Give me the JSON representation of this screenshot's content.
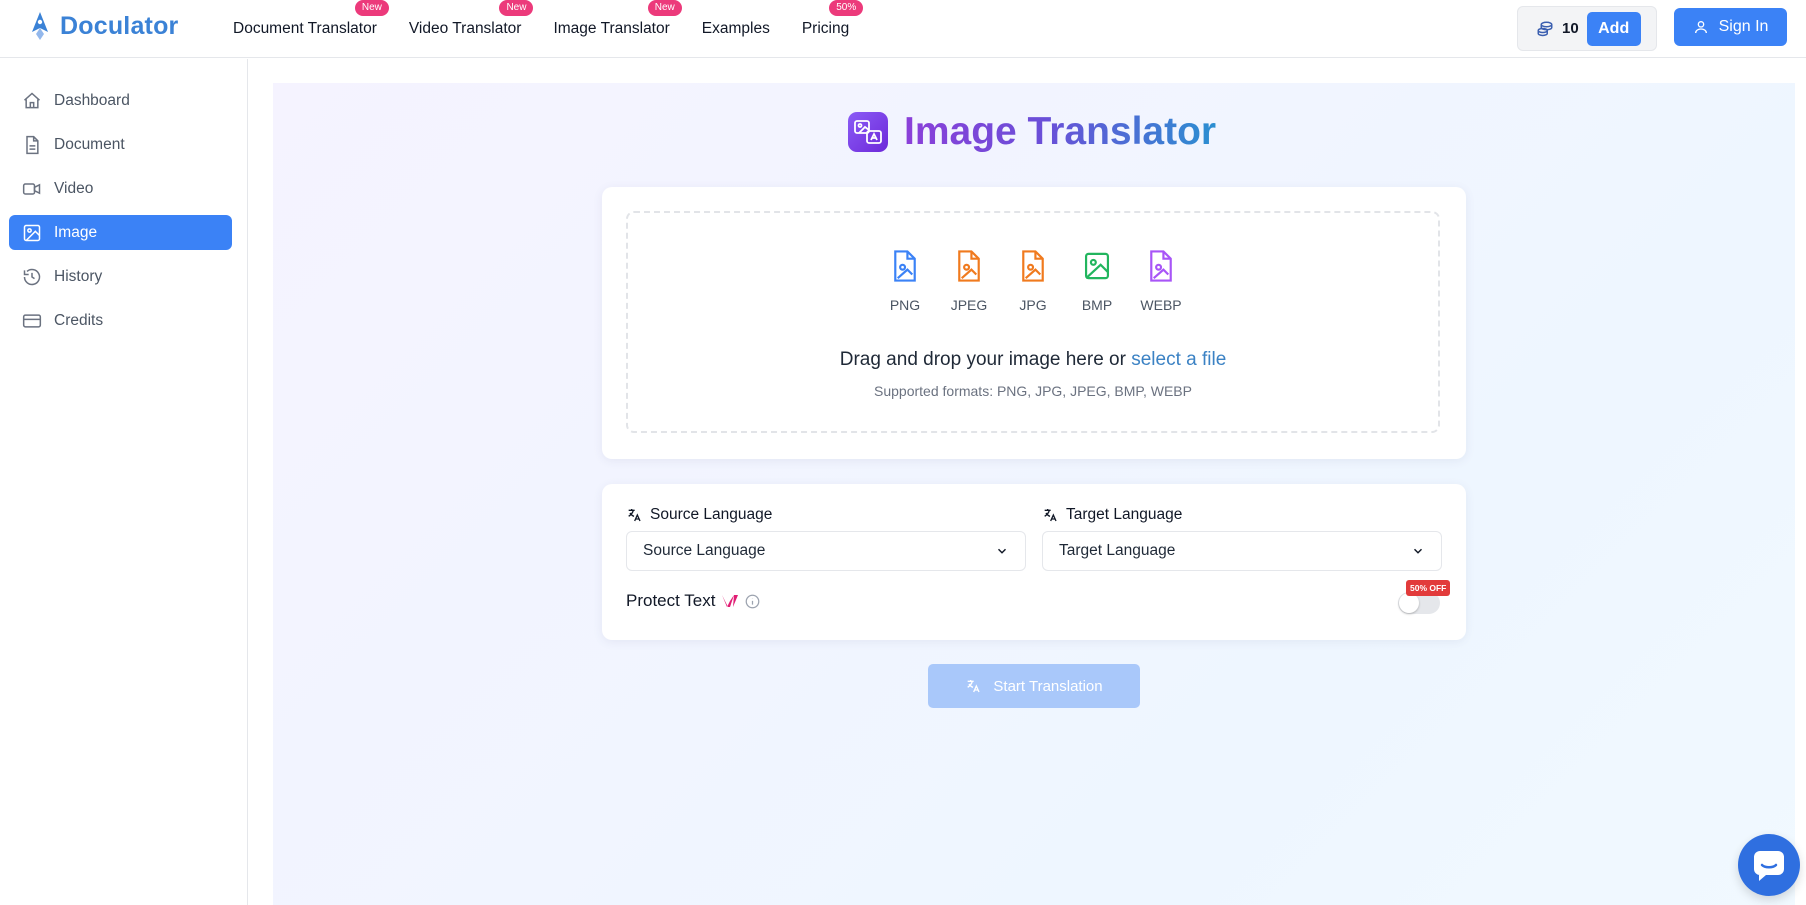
{
  "header": {
    "logo_text": "Doculator",
    "nav": [
      {
        "label": "Document Translator",
        "badge": "New"
      },
      {
        "label": "Video Translator",
        "badge": "New"
      },
      {
        "label": "Image Translator",
        "badge": "New"
      },
      {
        "label": "Examples",
        "badge": ""
      },
      {
        "label": "Pricing",
        "badge": "50%"
      }
    ],
    "credits_count": "10",
    "add_label": "Add",
    "signin_label": "Sign In"
  },
  "sidebar": {
    "items": [
      {
        "label": "Dashboard",
        "icon": "home-icon"
      },
      {
        "label": "Document",
        "icon": "document-icon"
      },
      {
        "label": "Video",
        "icon": "video-icon"
      },
      {
        "label": "Image",
        "icon": "image-icon",
        "active": true
      },
      {
        "label": "History",
        "icon": "history-icon"
      },
      {
        "label": "Credits",
        "icon": "credit-card-icon"
      }
    ]
  },
  "main": {
    "title": "Image Translator",
    "upload": {
      "formats": [
        {
          "label": "PNG",
          "color": "#3b82f6"
        },
        {
          "label": "JPEG",
          "color": "#f07a1e"
        },
        {
          "label": "JPG",
          "color": "#f07a1e"
        },
        {
          "label": "BMP",
          "color": "#22b55e"
        },
        {
          "label": "WEBP",
          "color": "#a855f7"
        }
      ],
      "drop_text": "Drag and drop your image here or",
      "select_link": "select a file",
      "supported": "Supported formats: PNG, JPG, JPEG, BMP, WEBP"
    },
    "source_label": "Source Language",
    "source_value": "Source Language",
    "target_label": "Target Language",
    "target_value": "Target Language",
    "protect_label": "Protect Text",
    "protect_badge": "50% OFF",
    "start_label": "Start Translation"
  },
  "colors": {
    "accent": "#3b82f6",
    "badge": "#ec3a7b",
    "off_badge": "#e23b3b"
  }
}
